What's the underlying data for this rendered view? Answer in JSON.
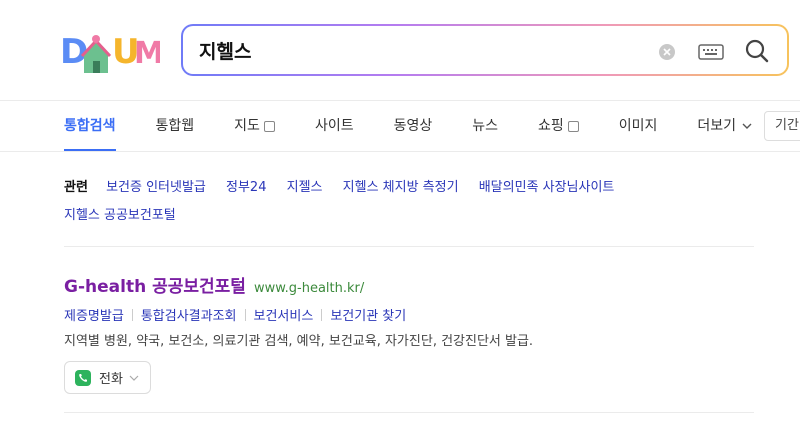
{
  "brand": {
    "logo_text": "DAUM"
  },
  "search": {
    "query": "지헬스"
  },
  "tabs": [
    {
      "label": "통합검색",
      "active": true
    },
    {
      "label": "통합웹"
    },
    {
      "label": "지도",
      "external": true
    },
    {
      "label": "사이트"
    },
    {
      "label": "동영상"
    },
    {
      "label": "뉴스"
    },
    {
      "label": "쇼핑",
      "external": true
    },
    {
      "label": "이미지"
    },
    {
      "label": "더보기",
      "dropdown": true
    }
  ],
  "period_filter": "기간",
  "related": {
    "label": "관련",
    "links": [
      "보건증 인터넷발급",
      "정부24",
      "지젤스",
      "지헬스 체지방 측정기",
      "배달의민족 사장님사이트",
      "지헬스 공공보건포털"
    ]
  },
  "result": {
    "title": "G-health 공공보건포털",
    "url": "www.g-health.kr/",
    "sublinks": [
      "제증명발급",
      "통합검사결과조회",
      "보건서비스",
      "보건기관 찾기"
    ],
    "description": "지역별 병원, 약국, 보건소, 의료기관 검색, 예약, 보건교육, 자가진단, 건강진단서 발급.",
    "call_label": "전화"
  },
  "colors": {
    "accent": "#3b6ef5",
    "link": "#2a36b8",
    "visited_title": "#7a1fa2",
    "url_green": "#3c8a3c"
  }
}
